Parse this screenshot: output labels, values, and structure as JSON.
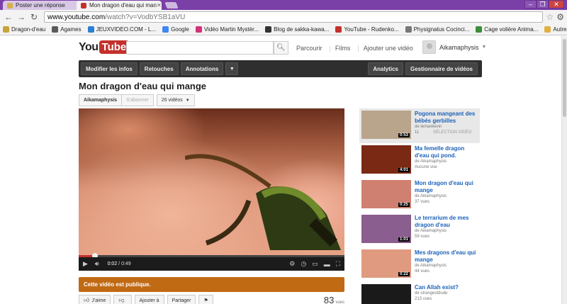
{
  "browser": {
    "tabs": [
      {
        "label": "Poster une réponse",
        "favicon_color": "#d4b14a"
      },
      {
        "label": "Mon dragon d'eau qui man",
        "favicon_color": "#c4302b"
      }
    ],
    "url_host": "www.youtube.com",
    "url_rest": "/watch?v=VodbYSB1aVU",
    "window_buttons": [
      "–",
      "❐",
      "✕"
    ],
    "bookmarks": [
      {
        "label": "Dragon-d'eau",
        "color": "#c8a33a"
      },
      {
        "label": "Agames",
        "color": "#5a5a5a"
      },
      {
        "label": "JEUXVIDEO.COM - L...",
        "color": "#2a7fd4"
      },
      {
        "label": "Google",
        "color": "#4285f4"
      },
      {
        "label": "Vidéo Martin Mystèr...",
        "color": "#d6307a"
      },
      {
        "label": "Blog de sakka-kawa...",
        "color": "#333333"
      },
      {
        "label": "YouTube - Rudenko...",
        "color": "#c4302b"
      },
      {
        "label": "Physignatus Cocinci...",
        "color": "#777777"
      },
      {
        "label": "Cage volière Anima...",
        "color": "#3a8f3a"
      }
    ],
    "other_bookmarks": "Autres favoris"
  },
  "header": {
    "logo_you": "You",
    "logo_tube": "Tube",
    "search_placeholder": "",
    "links": [
      "Parcourir",
      "Films",
      "Ajouter une vidéo"
    ],
    "username": "Aikamaphysis"
  },
  "owner_bar": {
    "left": [
      "Modifier les infos",
      "Retouches",
      "Annotations"
    ],
    "right": [
      "Analytics",
      "Gestionnaire de vidéos"
    ]
  },
  "video": {
    "title": "Mon dragon d'eau qui mange",
    "channel": "Aikamaphysis",
    "subscribe": "S'abonner",
    "video_count": "26 vidéos",
    "time_current": "0:02",
    "time_total": "0:49",
    "progress": 0.06,
    "notice": "Cette vidéo est publique.",
    "actions": [
      "J'aime",
      "Ajouter à",
      "Partager"
    ],
    "views": "83",
    "views_unit": "vues"
  },
  "related": [
    {
      "title": "Pogona mangeant des bébés gerbilles",
      "by": "de lemaxkevin",
      "views": "11",
      "tag": "SÉLECTION VIDÉO",
      "duration": "0:53",
      "thumb": "#b9a58c",
      "selected": true
    },
    {
      "title": "Ma femelle dragon d'eau qui pond.",
      "by": "de Aikamaphysis",
      "views": "Aucune vue",
      "tag": "",
      "duration": "4:01",
      "thumb": "#7a2a14",
      "selected": false
    },
    {
      "title": "Mon dragon d'eau qui mange",
      "by": "de Aikamaphysis",
      "views": "37 vues",
      "tag": "",
      "duration": "0:25",
      "thumb": "#d08070",
      "selected": false
    },
    {
      "title": "Le terrarium de mes dragon d'eau",
      "by": "de Aikamaphysis",
      "views": "59 vues",
      "tag": "",
      "duration": "1:01",
      "thumb": "#8a5e8e",
      "selected": false
    },
    {
      "title": "Mes dragons d'eau qui mange",
      "by": "de Aikamaphysis",
      "views": "44 vues",
      "tag": "",
      "duration": "0:22",
      "thumb": "#e09a80",
      "selected": false
    },
    {
      "title": "Can Allah exist?",
      "by": "de strangestdude",
      "views": "213 vues",
      "tag": "",
      "duration": "",
      "thumb": "#1a1a1a",
      "selected": false
    }
  ]
}
